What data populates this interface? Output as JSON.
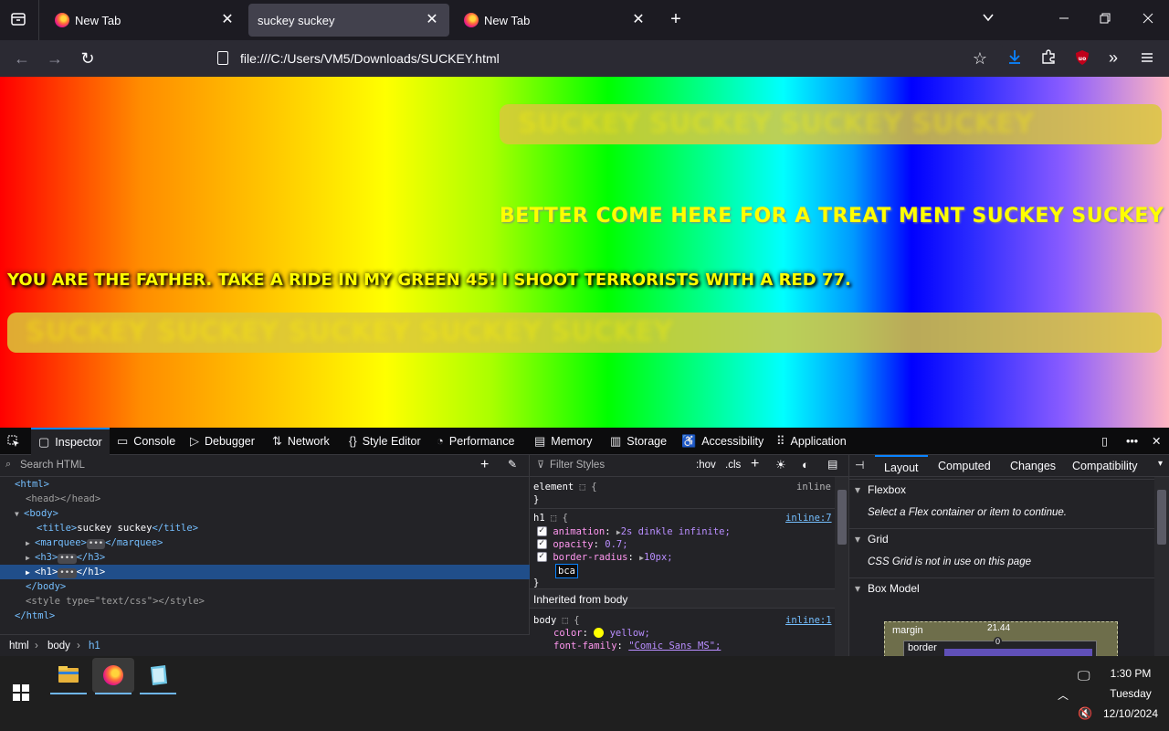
{
  "browser": {
    "tabs": [
      {
        "title": "New Tab",
        "active": false
      },
      {
        "title": "suckey suckey",
        "active": true
      },
      {
        "title": "New Tab",
        "active": false
      }
    ],
    "url": "file:///C:/Users/VM5/Downloads/SUCKEY.html"
  },
  "page": {
    "h3_text": "BETTER COME HERE FOR A TREAT MENT SUCKEY SUCKEY",
    "h1_text": "YOU ARE THE FATHER. TAKE A RIDE IN MY GREEN 45! I SHOOT TERRORISTS WITH A RED 77.",
    "h1_bar_text": "SUCKEY SUCKEY SUCKEY SUCKEY SUCKEY",
    "marquee_text": "SUCKEY SUCKEY SUCKEY SUCKEY"
  },
  "devtools": {
    "tabs": [
      "Inspector",
      "Console",
      "Debugger",
      "Network",
      "Style Editor",
      "Performance",
      "Memory",
      "Storage",
      "Accessibility",
      "Application"
    ],
    "search_placeholder": "Search HTML",
    "markup": {
      "html_open": "<html>",
      "head": "<head></head>",
      "body_open": "<body>",
      "title_open": "<title>",
      "title_text": "suckey suckey",
      "title_close": "</title>",
      "marquee_open": "<marquee>",
      "marquee_close": "</marquee>",
      "h3_open": "<h3>",
      "h3_close": "</h3>",
      "h1_open": "<h1>",
      "h1_close": "</h1>",
      "body_close": "</body>",
      "style_open": "<style",
      "style_attr": "type=",
      "style_val": "\"text/css\"",
      "style_close": "></style>",
      "html_close": "</html>",
      "ellipsis": "•••"
    },
    "breadcrumbs": [
      "html",
      "body",
      "h1"
    ],
    "rules": {
      "filter_placeholder": "Filter Styles",
      "hov": ":hov",
      "cls": ".cls",
      "element_selector": "element",
      "inline_label": "inline",
      "h1_selector": "h1",
      "h1_source": "inline:7",
      "h1_props": [
        {
          "name": "animation",
          "value": "2s dinkle infinite;"
        },
        {
          "name": "opacity",
          "value": "0.7;"
        },
        {
          "name": "border-radius",
          "value": "10px;"
        }
      ],
      "editing_value": "bca",
      "inherited_header": "Inherited from body",
      "body_selector": "body",
      "body_source": "inline:1",
      "body_props": [
        {
          "name": "color",
          "value": "yellow;"
        },
        {
          "name": "font-family",
          "value": "\"Comic Sans MS\";"
        }
      ]
    },
    "layout": {
      "tabs": [
        "Layout",
        "Computed",
        "Changes",
        "Compatibility"
      ],
      "flexbox_title": "Flexbox",
      "flexbox_msg": "Select a Flex container or item to continue.",
      "grid_title": "Grid",
      "grid_msg": "CSS Grid is not in use on this page",
      "boxmodel_title": "Box Model",
      "margin_label": "margin",
      "margin_value": "21.44",
      "border_label": "border",
      "border_value": "0"
    }
  },
  "taskbar": {
    "time": "1:30 PM",
    "day": "Tuesday",
    "date": "12/10/2024"
  },
  "colors": {
    "accent": "#0a84ff",
    "text_yellow": "#ffff00"
  }
}
